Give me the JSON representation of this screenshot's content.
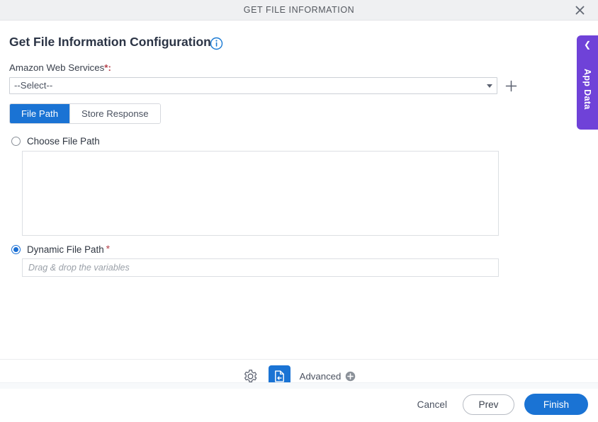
{
  "window": {
    "title": "GET FILE INFORMATION",
    "close_icon": "close-icon"
  },
  "page": {
    "heading": "Get File Information Configuration",
    "info_icon": "info-icon"
  },
  "connection": {
    "label": "Amazon Web Services",
    "required_marker": "*:",
    "selected_value": "--Select--",
    "add_icon": "plus-icon"
  },
  "tabs": [
    {
      "label": "File Path",
      "active": true
    },
    {
      "label": "Store Response",
      "active": false
    }
  ],
  "file_path": {
    "choose_option_label": "Choose File Path",
    "choose_option_selected": false,
    "choose_textarea_value": "",
    "dynamic_option_label": "Dynamic File Path",
    "dynamic_required_marker": "*",
    "dynamic_option_selected": true,
    "dynamic_input_value": "",
    "dynamic_input_placeholder": "Drag & drop the variables"
  },
  "app_data_panel": {
    "label": "App Data",
    "collapse_icon": "chevron-left-icon"
  },
  "toolbar": {
    "settings_icon": "gear-icon",
    "document_icon": "document-import-icon",
    "advanced_label": "Advanced",
    "advanced_add_icon": "plus-circle-icon"
  },
  "footer": {
    "cancel_label": "Cancel",
    "prev_label": "Prev",
    "finish_label": "Finish"
  },
  "colors": {
    "accent_blue": "#1a73d4",
    "purple": "#6f42d8",
    "required_red": "#b3404a",
    "titlebar_bg": "#eff0f2"
  }
}
